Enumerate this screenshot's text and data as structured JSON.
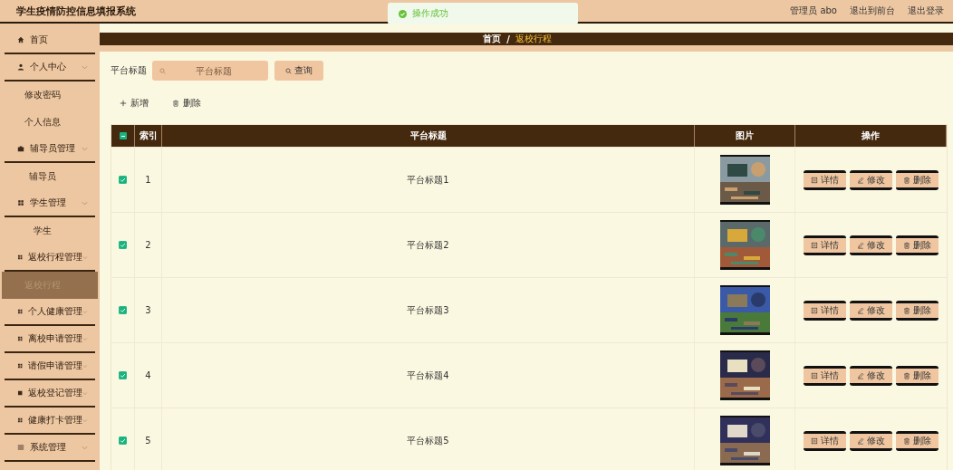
{
  "header": {
    "title": "学生疫情防控信息填报系统",
    "user": "管理员 abo",
    "links": [
      "退出到前台",
      "退出登录"
    ]
  },
  "toast": {
    "message": "操作成功"
  },
  "sidebar": {
    "items": [
      {
        "label": "首页"
      },
      {
        "label": "个人中心",
        "children": [
          {
            "label": "修改密码",
            "selected": false
          },
          {
            "label": "个人信息",
            "selected": false
          }
        ]
      },
      {
        "label": "辅导员管理",
        "children": [
          {
            "label": "辅导员",
            "selected": false
          }
        ]
      },
      {
        "label": "学生管理",
        "children": [
          {
            "label": "学生",
            "selected": false
          }
        ]
      },
      {
        "label": "返校行程管理",
        "children": [
          {
            "label": "返校行程",
            "selected": true
          }
        ]
      },
      {
        "label": "个人健康管理"
      },
      {
        "label": "离校申请管理"
      },
      {
        "label": "请假申请管理"
      },
      {
        "label": "返校登记管理"
      },
      {
        "label": "健康打卡管理"
      },
      {
        "label": "系统管理"
      }
    ]
  },
  "breadcrumb": {
    "items": [
      "首页",
      "返校行程"
    ],
    "separator": "/"
  },
  "search": {
    "label": "平台标题",
    "placeholder": "平台标题",
    "button": "查询"
  },
  "actions": [
    "新增",
    "删除"
  ],
  "table": {
    "select_all": {
      "indeterminate": true
    },
    "columns": [
      "索引",
      "平台标题",
      "图片",
      "操作"
    ],
    "rows": [
      {
        "checked": true,
        "index": "1",
        "title": "平台标题1",
        "image": {
          "kind": "picture"
        },
        "buttons": [
          "详情",
          "修改",
          "删除"
        ]
      },
      {
        "checked": true,
        "index": "2",
        "title": "平台标题2",
        "image": {
          "kind": "picture"
        },
        "buttons": [
          "详情",
          "修改",
          "删除"
        ]
      },
      {
        "checked": true,
        "index": "3",
        "title": "平台标题3",
        "image": {
          "kind": "picture"
        },
        "buttons": [
          "详情",
          "修改",
          "删除"
        ]
      },
      {
        "checked": true,
        "index": "4",
        "title": "平台标题4",
        "image": {
          "kind": "picture"
        },
        "buttons": [
          "详情",
          "修改",
          "删除"
        ]
      },
      {
        "checked": true,
        "index": "5",
        "title": "平台标题5",
        "image": {
          "kind": "picture"
        },
        "buttons": [
          "详情",
          "修改",
          "删除"
        ]
      }
    ]
  }
}
